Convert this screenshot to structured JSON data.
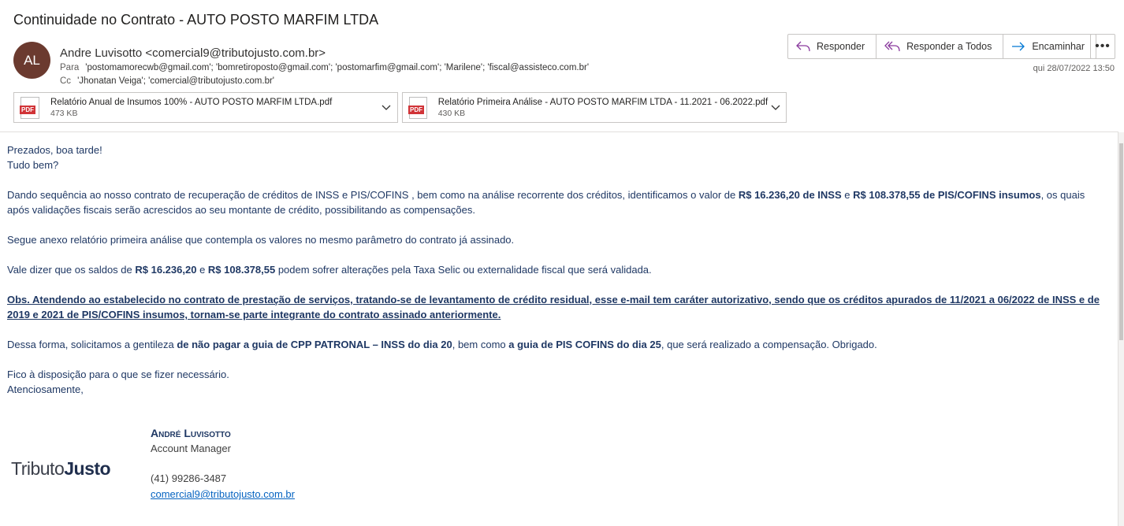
{
  "subject": "Continuidade no Contrato - AUTO POSTO MARFIM LTDA",
  "sender": {
    "initials": "AL",
    "display": "Andre Luvisotto <comercial9@tributojusto.com.br>",
    "to_label": "Para",
    "to": "'postomamorecwb@gmail.com'; 'bomretiroposto@gmail.com'; 'postomarfim@gmail.com'; 'Marilene'; 'fiscal@assisteco.com.br'",
    "cc_label": "Cc",
    "cc": "'Jhonatan Veiga'; 'comercial@tributojusto.com.br'"
  },
  "actions": {
    "reply": "Responder",
    "reply_all": "Responder a Todos",
    "forward": "Encaminhar",
    "more": "•••"
  },
  "date": "qui 28/07/2022 13:50",
  "attachments": [
    {
      "name": "Relatório Anual de Insumos 100% - AUTO POSTO MARFIM LTDA.pdf",
      "size": "473 KB",
      "type": "PDF"
    },
    {
      "name": "Relatório Primeira Análise - AUTO POSTO MARFIM LTDA - 11.2021 - 06.2022.pdf",
      "size": "430 KB",
      "type": "PDF"
    }
  ],
  "body": {
    "greeting1": "Prezados, boa tarde!",
    "greeting2": "Tudo bem?",
    "p1_a": "Dando sequência ao nosso contrato de recuperação de créditos de INSS e PIS/COFINS , bem como na análise recorrente dos créditos, identificamos o valor de ",
    "p1_b": "R$ 16.236,20 de INSS",
    "p1_c": " e ",
    "p1_d": "R$ 108.378,55 de PIS/COFINS insumos",
    "p1_e": ", os quais após validações fiscais serão acrescidos ao seu montante de crédito, possibilitando as compensações.",
    "p2": "Segue anexo relatório primeira análise que contempla os valores no mesmo parâmetro do contrato já assinado.",
    "p3_a": "Vale dizer que os saldos de ",
    "p3_b": "R$ 16.236,20",
    "p3_c": " e ",
    "p3_d": "R$ 108.378,55",
    "p3_e": " podem sofrer alterações pela Taxa Selic ou externalidade fiscal que será validada.",
    "obs": "Obs. Atendendo ao estabelecido no contrato de prestação de serviços, tratando-se de levantamento de crédito residual, esse e-mail tem caráter autorizativo, sendo que os créditos apurados de 11/2021 a 06/2022 de INSS e de 2019 e 2021 de PIS/COFINS insumos, tornam-se parte integrante do contrato assinado anteriormente.",
    "p4_a": "Dessa forma, solicitamos a gentileza ",
    "p4_b": "de não pagar a guia de CPP PATRONAL – INSS do dia 20",
    "p4_c": ", bem como ",
    "p4_d": "a guia de PIS COFINS do dia 25",
    "p4_e": ",  que será realizado a compensação. Obrigado.",
    "closing1": "Fico à disposição para o que se fizer necessário.",
    "closing2": "Atenciosamente,"
  },
  "signature": {
    "name": "André Luvisotto",
    "role": "Account Manager",
    "phone": "(41) 99286-3487",
    "email": "comercial9@tributojusto.com.br",
    "logo_a": "Tributo",
    "logo_b": "Justo"
  },
  "colors": {
    "body_text": "#1f3864",
    "avatar": "#6b3a2f",
    "link": "#0563c1",
    "pdf_red": "#d13438"
  }
}
